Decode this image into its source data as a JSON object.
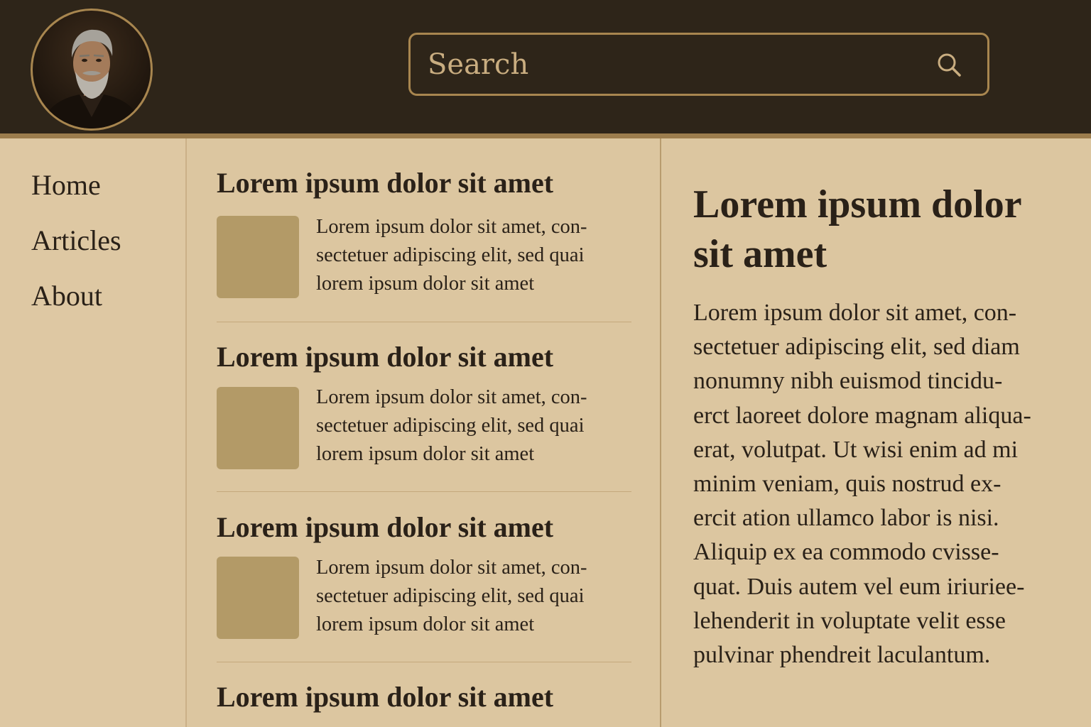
{
  "header": {
    "search": {
      "placeholder": "Search",
      "icon": "search-icon"
    },
    "avatar": {
      "icon": "avatar-portrait"
    }
  },
  "sidebar": {
    "items": [
      {
        "label": "Home"
      },
      {
        "label": "Articles"
      },
      {
        "label": "About"
      }
    ]
  },
  "feed": {
    "articles": [
      {
        "title": "Lorem ipsum dolor sit amet",
        "excerpt": [
          "Lorem ipsum dolor sit amet, con-",
          "sectetuer adipiscing elit, sed quai",
          "lorem ipsum dolor sit amet"
        ]
      },
      {
        "title": "Lorem ipsum dolor sit amet",
        "excerpt": [
          "Lorem ipsum dolor sit amet, con-",
          "sectetuer adipiscing elit, sed quai",
          "lorem ipsum dolor sit amet"
        ]
      },
      {
        "title": "Lorem ipsum dolor sit amet",
        "excerpt": [
          "Lorem ipsum dolor sit amet, con-",
          "sectetuer adipiscing elit, sed quai",
          "lorem ipsum dolor sit amet"
        ]
      },
      {
        "title": "Lorem ipsum dolor sit amet"
      }
    ]
  },
  "detail": {
    "title_lines": [
      "Lorem ipsum dolor",
      "sit amet"
    ],
    "body_lines": [
      "Lorem ipsum dolor sit amet, con-",
      "sectetuer adipiscing elit, sed diam",
      "nonumny nibh euismod tincidu-",
      "erct laoreet dolore magnam aliqua-",
      "erat, volutpat. Ut wisi enim ad mi",
      "minim veniam, quis nostrud ex-",
      "ercit ation ullamco labor is nisi.",
      "Aliquip ex ea commodo cvisse-",
      "quat. Duis autem vel eum iriuriee-",
      "lehenderit in voluptate velit esse",
      "pulvinar phendreit laculantum."
    ]
  },
  "colors": {
    "header_bg": "#2e2519",
    "accent_gold": "#a8864f",
    "page_bg": "#dcc6a0",
    "thumbnail": "#b39a67",
    "text": "#2a2118"
  }
}
